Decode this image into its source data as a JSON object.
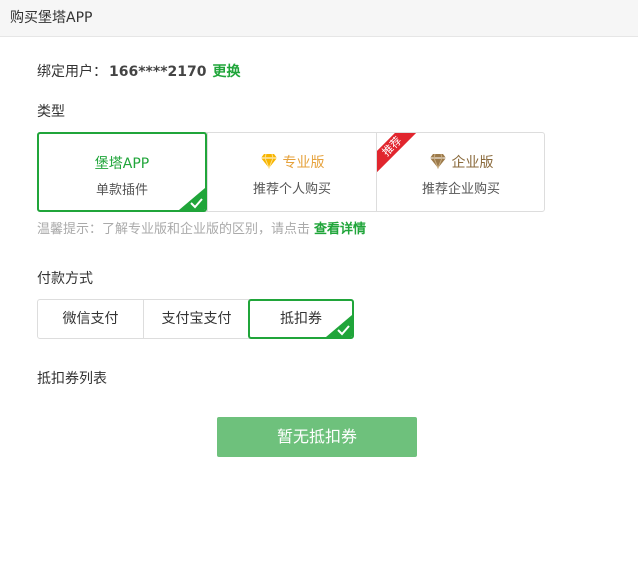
{
  "window": {
    "title": "购买堡塔APP"
  },
  "account": {
    "label": "绑定用户：",
    "phone": "166****2170",
    "change_link": "更换"
  },
  "type_section": {
    "label": "类型",
    "options": [
      {
        "name": "堡塔APP",
        "desc": "单款插件",
        "selected": true
      },
      {
        "name": "专业版",
        "desc": "推荐个人购买",
        "selected": false
      },
      {
        "name": "企业版",
        "desc": "推荐企业购买",
        "selected": false,
        "ribbon": "推荐"
      }
    ]
  },
  "tip": {
    "text": "温馨提示：了解专业版和企业版的区别，请点击",
    "link": "查看详情"
  },
  "payment_section": {
    "label": "付款方式",
    "options": [
      {
        "label": "微信支付",
        "selected": false
      },
      {
        "label": "支付宝支付",
        "selected": false
      },
      {
        "label": "抵扣券",
        "selected": true
      }
    ]
  },
  "coupon_section": {
    "label": "抵扣券列表",
    "empty_button": "暂无抵扣券"
  },
  "colors": {
    "accent": "#20a53a",
    "button": "#6ec17c",
    "ribbon": "#e1262e",
    "pro": "#e6a23c",
    "enterprise": "#8a6a3c"
  }
}
